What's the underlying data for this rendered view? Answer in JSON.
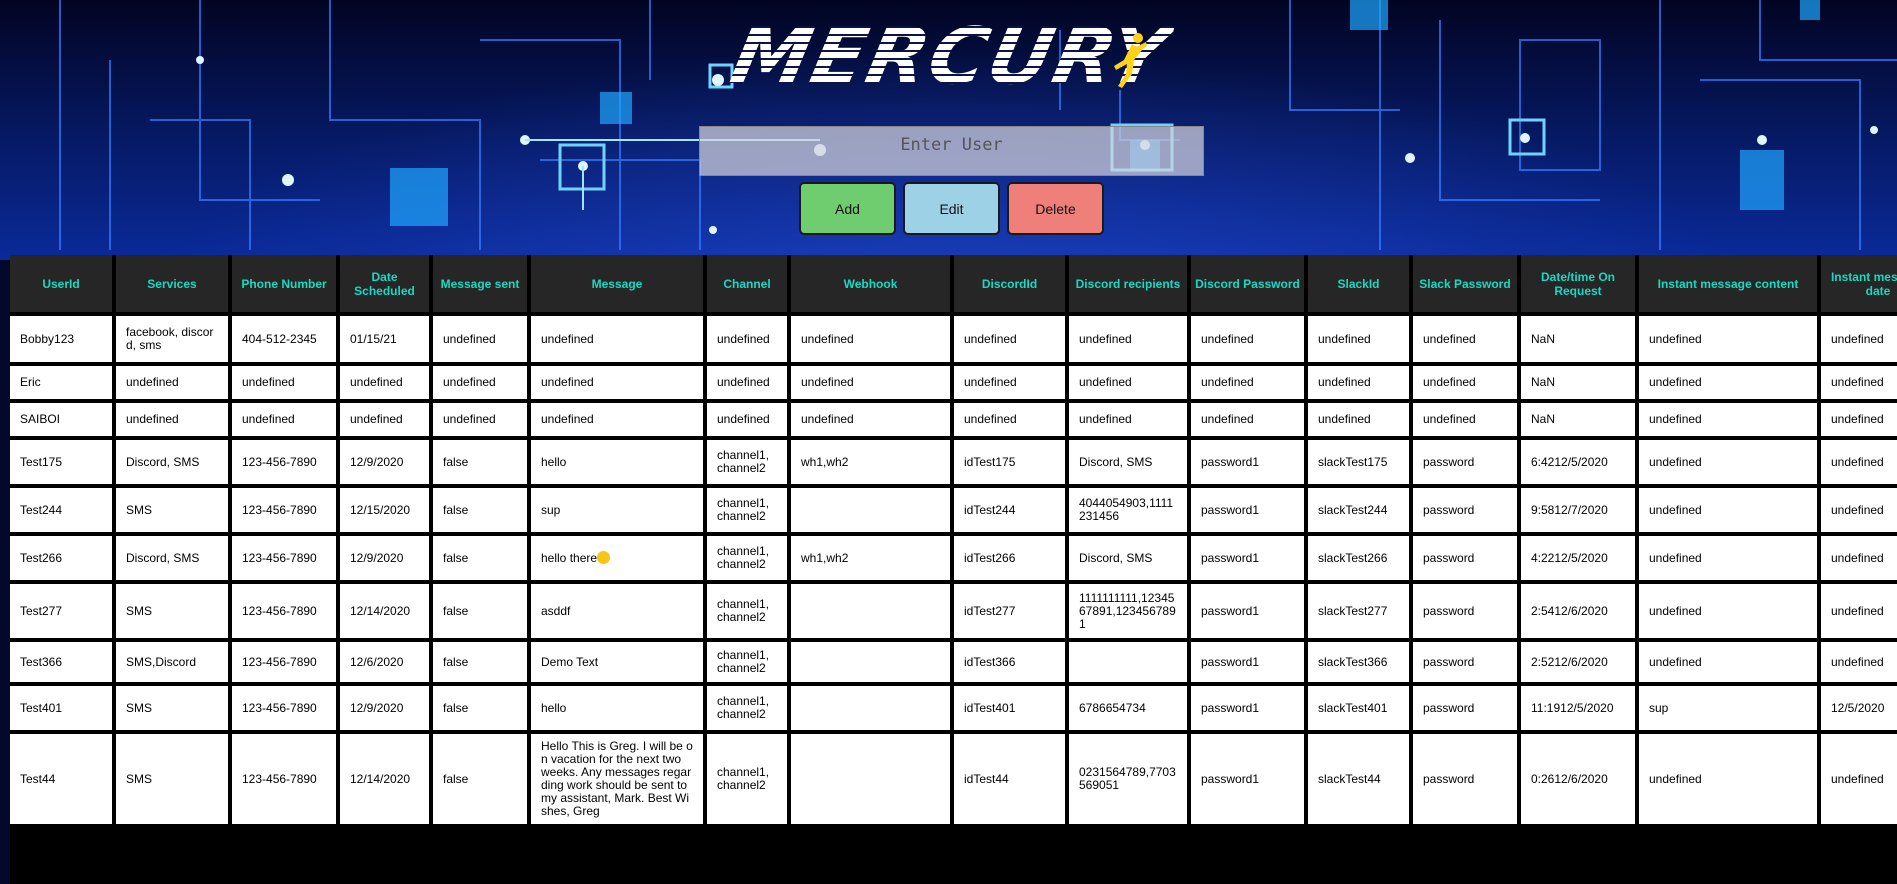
{
  "app": {
    "logo_text": "MERCURY"
  },
  "search": {
    "placeholder": "Enter User"
  },
  "actions": {
    "add_label": "Add",
    "edit_label": "Edit",
    "delete_label": "Delete"
  },
  "colors": {
    "header_bg": "#262626",
    "header_text": "#17d9c4",
    "add_button": "#6fcc6f",
    "edit_button": "#9dd2e6",
    "delete_button": "#ef8079",
    "background": "#0a2a9a"
  },
  "table": {
    "columns": [
      "UserId",
      "Services",
      "Phone Number",
      "Date Scheduled",
      "Message sent",
      "Message",
      "Channel",
      "Webhook",
      "DiscordId",
      "Discord recipients",
      "Discord Password",
      "SlackId",
      "Slack Password",
      "Date/time On Request",
      "Instant message content",
      "Instant message date"
    ],
    "rows": [
      [
        "Bobby123",
        "facebook, discord, sms",
        "404-512-2345",
        "01/15/21",
        "undefined",
        "undefined",
        "undefined",
        "undefined",
        "undefined",
        "undefined",
        "undefined",
        "undefined",
        "undefined",
        "NaN",
        "undefined",
        "undefined"
      ],
      [
        "Eric",
        "undefined",
        "undefined",
        "undefined",
        "undefined",
        "undefined",
        "undefined",
        "undefined",
        "undefined",
        "undefined",
        "undefined",
        "undefined",
        "undefined",
        "NaN",
        "undefined",
        "undefined"
      ],
      [
        "SAIBOI",
        "undefined",
        "undefined",
        "undefined",
        "undefined",
        "undefined",
        "undefined",
        "undefined",
        "undefined",
        "undefined",
        "undefined",
        "undefined",
        "undefined",
        "NaN",
        "undefined",
        "undefined"
      ],
      [
        "Test175",
        "Discord, SMS",
        "123-456-7890",
        "12/9/2020",
        "false",
        "hello",
        "channel1, channel2",
        "wh1,wh2",
        "idTest175",
        "Discord, SMS",
        "password1",
        "slackTest175",
        "password",
        "6:4212/5/2020",
        "undefined",
        "undefined"
      ],
      [
        "Test244",
        "SMS",
        "123-456-7890",
        "12/15/2020",
        "false",
        "sup",
        "channel1, channel2",
        "",
        "idTest244",
        "4044054903,1111231456",
        "password1",
        "slackTest244",
        "password",
        "9:5812/7/2020",
        "undefined",
        "undefined"
      ],
      [
        "Test266",
        "Discord, SMS",
        "123-456-7890",
        "12/9/2020",
        "false",
        "hello there",
        "channel1, channel2",
        "wh1,wh2",
        "idTest266",
        "Discord, SMS",
        "password1",
        "slackTest266",
        "password",
        "4:2212/5/2020",
        "undefined",
        "undefined"
      ],
      [
        "Test277",
        "SMS",
        "123-456-7890",
        "12/14/2020",
        "false",
        "asddf",
        "channel1, channel2",
        "",
        "idTest277",
        "1111111111,1234567891,1234567891",
        "password1",
        "slackTest277",
        "password",
        "2:5412/6/2020",
        "undefined",
        "undefined"
      ],
      [
        "Test366",
        "SMS,Discord",
        "123-456-7890",
        "12/6/2020",
        "false",
        "Demo Text",
        "channel1, channel2",
        "",
        "idTest366",
        "",
        "password1",
        "slackTest366",
        "password",
        "2:5212/6/2020",
        "undefined",
        "undefined"
      ],
      [
        "Test401",
        "SMS",
        "123-456-7890",
        "12/9/2020",
        "false",
        "hello",
        "channel1, channel2",
        "",
        "idTest401",
        "6786654734",
        "password1",
        "slackTest401",
        "password",
        "11:1912/5/2020",
        "sup",
        "12/5/2020"
      ],
      [
        "Test44",
        "SMS",
        "123-456-7890",
        "12/14/2020",
        "false",
        "Hello  This is Greg. I will be on vacation for the next two weeks. Any messages regarding work should be sent to my assistant, Mark. Best Wishes, Greg",
        "channel1, channel2",
        "",
        "idTest44",
        "0231564789,7703569051",
        "password1",
        "slackTest44",
        "password",
        "0:2612/6/2020",
        "undefined",
        "undefined"
      ]
    ]
  }
}
